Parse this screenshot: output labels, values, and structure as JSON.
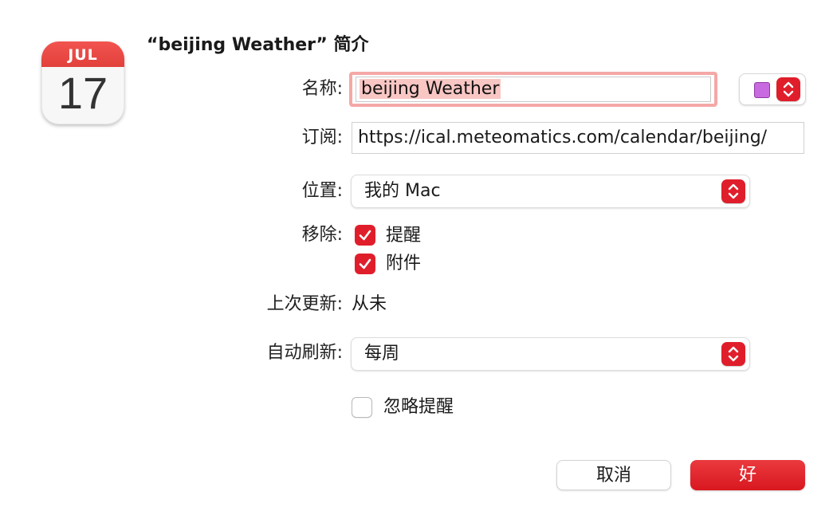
{
  "icon": {
    "month": "JUL",
    "day": "17",
    "name": "calendar-app-icon"
  },
  "dialog": {
    "title": "“beijing Weather” 简介"
  },
  "fields": {
    "name_label": "名称:",
    "name_value": "beijing Weather",
    "subscribe_label": "订阅:",
    "subscribe_url": "https://ical.meteomatics.com/calendar/beijing/",
    "location_label": "位置:",
    "location_value": "我的 Mac",
    "remove_label": "移除:",
    "remove_alerts_label": "提醒",
    "remove_alerts_checked": true,
    "remove_attachments_label": "附件",
    "remove_attachments_checked": true,
    "last_updated_label": "上次更新:",
    "last_updated_value": "从未",
    "auto_refresh_label": "自动刷新:",
    "auto_refresh_value": "每周",
    "ignore_alerts_label": "忽略提醒",
    "ignore_alerts_checked": false
  },
  "colors": {
    "calendar_color": "#c86ae0",
    "accent": "#e01e2b"
  },
  "buttons": {
    "cancel": "取消",
    "ok": "好"
  }
}
